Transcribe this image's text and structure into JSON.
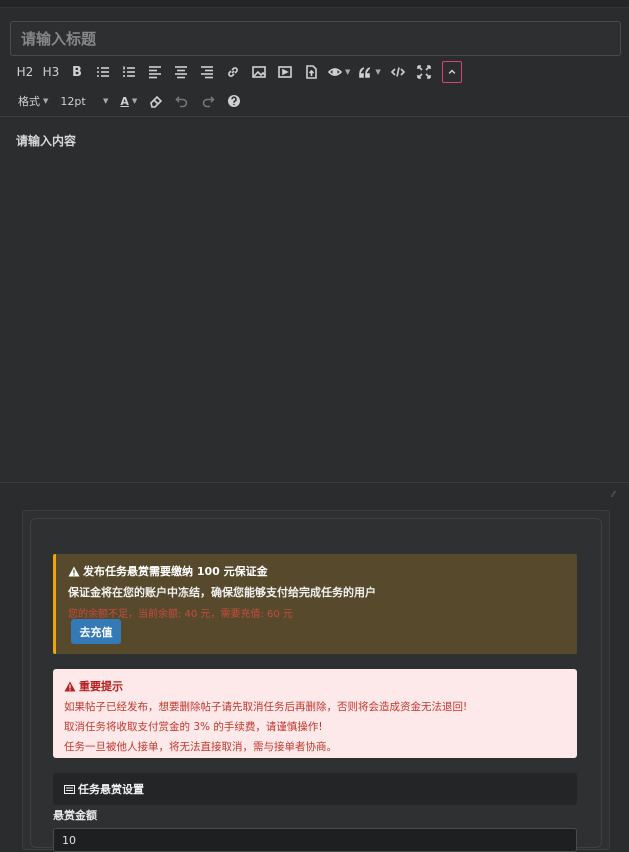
{
  "editor": {
    "title_placeholder": "请输入标题",
    "content_placeholder": "请输入内容",
    "toolbar": {
      "h2": "H2",
      "h3": "H3",
      "bold": "B",
      "format_label": "格式",
      "size_label": "12pt",
      "font_color_label": "A"
    }
  },
  "deposit_alert": {
    "title": "发布任务悬赏需要缴纳 100 元保证金",
    "description": "保证金将在您的账户中冻结，确保您能够支付给完成任务的用户",
    "balance_note": "您的余额不足，当前余额: 40 元，需要充值: 60 元",
    "recharge_button": "去充值"
  },
  "important_notice": {
    "title": "重要提示",
    "lines": [
      "如果帖子已经发布，想要删除帖子请先取消任务后再删除，否则将会造成资金无法退回!",
      "取消任务将收取支付赏金的 3% 的手续费，请谨慎操作!",
      "任务一旦被他人接单，将无法直接取消，需与接单者协商。"
    ]
  },
  "task_settings": {
    "header": "任务悬赏设置",
    "amount_label": "悬赏金额",
    "amount_value": "10"
  },
  "colors": {
    "warning_accent": "#f0a500",
    "primary_button": "#337ab7",
    "danger_text": "#c0392b",
    "active_border": "#d9417a"
  }
}
